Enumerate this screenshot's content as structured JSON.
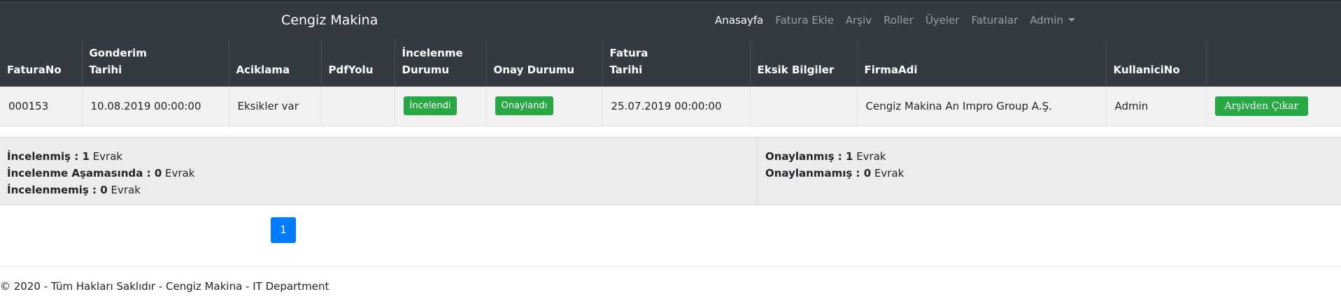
{
  "navbar": {
    "brand": "Cengiz Makina",
    "items": [
      "Anasayfa",
      "Fatura Ekle",
      "Arşiv",
      "Roller",
      "Üyeler",
      "Faturalar",
      "Admin"
    ]
  },
  "table": {
    "headers": {
      "fatura_no": "FaturaNo",
      "gonderim_1": "Gonderim",
      "gonderim_2": "Tarihi",
      "aciklama": "Aciklama",
      "pdf_yolu": "PdfYolu",
      "inceleme_1": "İncelenme",
      "inceleme_2": "Durumu",
      "onay": "Onay Durumu",
      "fatura_tarihi_1": "Fatura",
      "fatura_tarihi_2": "Tarihi",
      "eksik": "Eksik Bilgiler",
      "firma": "FirmaAdi",
      "kullanici": "KullaniciNo"
    },
    "rows": [
      {
        "fatura_no": "000153",
        "gonderim_tarihi": "10.08.2019 00:00:00",
        "aciklama": "Eksikler var",
        "pdf_yolu": "",
        "inceleme_durumu": "İncelendi",
        "onay_durumu": "Onaylandı",
        "fatura_tarihi": "25.07.2019 00:00:00",
        "eksik_bilgiler": "",
        "firma_adi": "Cengiz Makina An Impro Group A.Ş.",
        "kullanici_no": "Admin",
        "action": "Arşivden Çıkar"
      }
    ]
  },
  "summary": {
    "incelenmis_label": "İncelenmiş : ",
    "incelenmis_count": "1",
    "inceleme_asamasinda_label": "İncelenme Aşamasında : ",
    "inceleme_asamasinda_count": "0",
    "incelenmemis_label": "İncelenmemiş : ",
    "incelenmemis_count": "0",
    "onaylanmis_label": "Onaylanmış : ",
    "onaylanmis_count": "1",
    "onaylanmamis_label": "Onaylanmamış : ",
    "onaylanmamis_count": "0",
    "unit": "Evrak"
  },
  "pagination": {
    "current": "1"
  },
  "footer": {
    "text": "© 2020 - Tüm Hakları Saklıdır - Cengiz Makina - IT Department"
  },
  "colors": {
    "navbar": "#343a40",
    "success": "#28a745",
    "primary": "#007bff"
  }
}
